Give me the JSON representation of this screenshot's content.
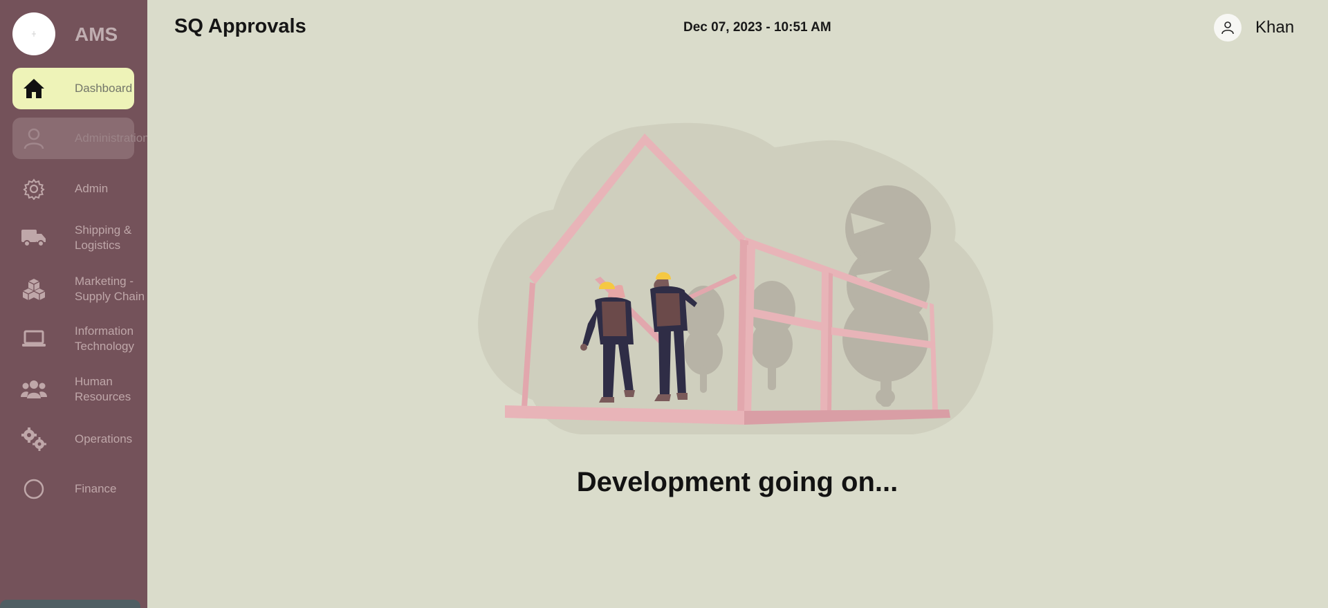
{
  "app": {
    "name": "AMS"
  },
  "header": {
    "title": "SQ Approvals",
    "datetime": "Dec 07, 2023 - 10:51 AM",
    "user_name": "Khan"
  },
  "sidebar": {
    "items": [
      {
        "label": "Dashboard",
        "icon": "home-icon",
        "state": "active"
      },
      {
        "label": "Administration",
        "icon": "user-icon",
        "state": "hover"
      },
      {
        "label": "Admin",
        "icon": "gear-icon"
      },
      {
        "label": "Shipping & Logistics",
        "icon": "truck-icon"
      },
      {
        "label": "Marketing - Supply Chain",
        "icon": "boxes-icon"
      },
      {
        "label": "Information Technology",
        "icon": "laptop-icon"
      },
      {
        "label": "Human Resources",
        "icon": "users-icon"
      },
      {
        "label": "Operations",
        "icon": "gears-icon"
      },
      {
        "label": "Finance",
        "icon": "circle-icon"
      }
    ]
  },
  "main": {
    "message": "Development going on..."
  },
  "colors": {
    "sidebar_bg": "#74525a",
    "page_bg": "#dadccb",
    "active_item_bg": "#eef3b8",
    "illustration_pink": "#e8b4b8",
    "hard_hat": "#f5c842"
  }
}
